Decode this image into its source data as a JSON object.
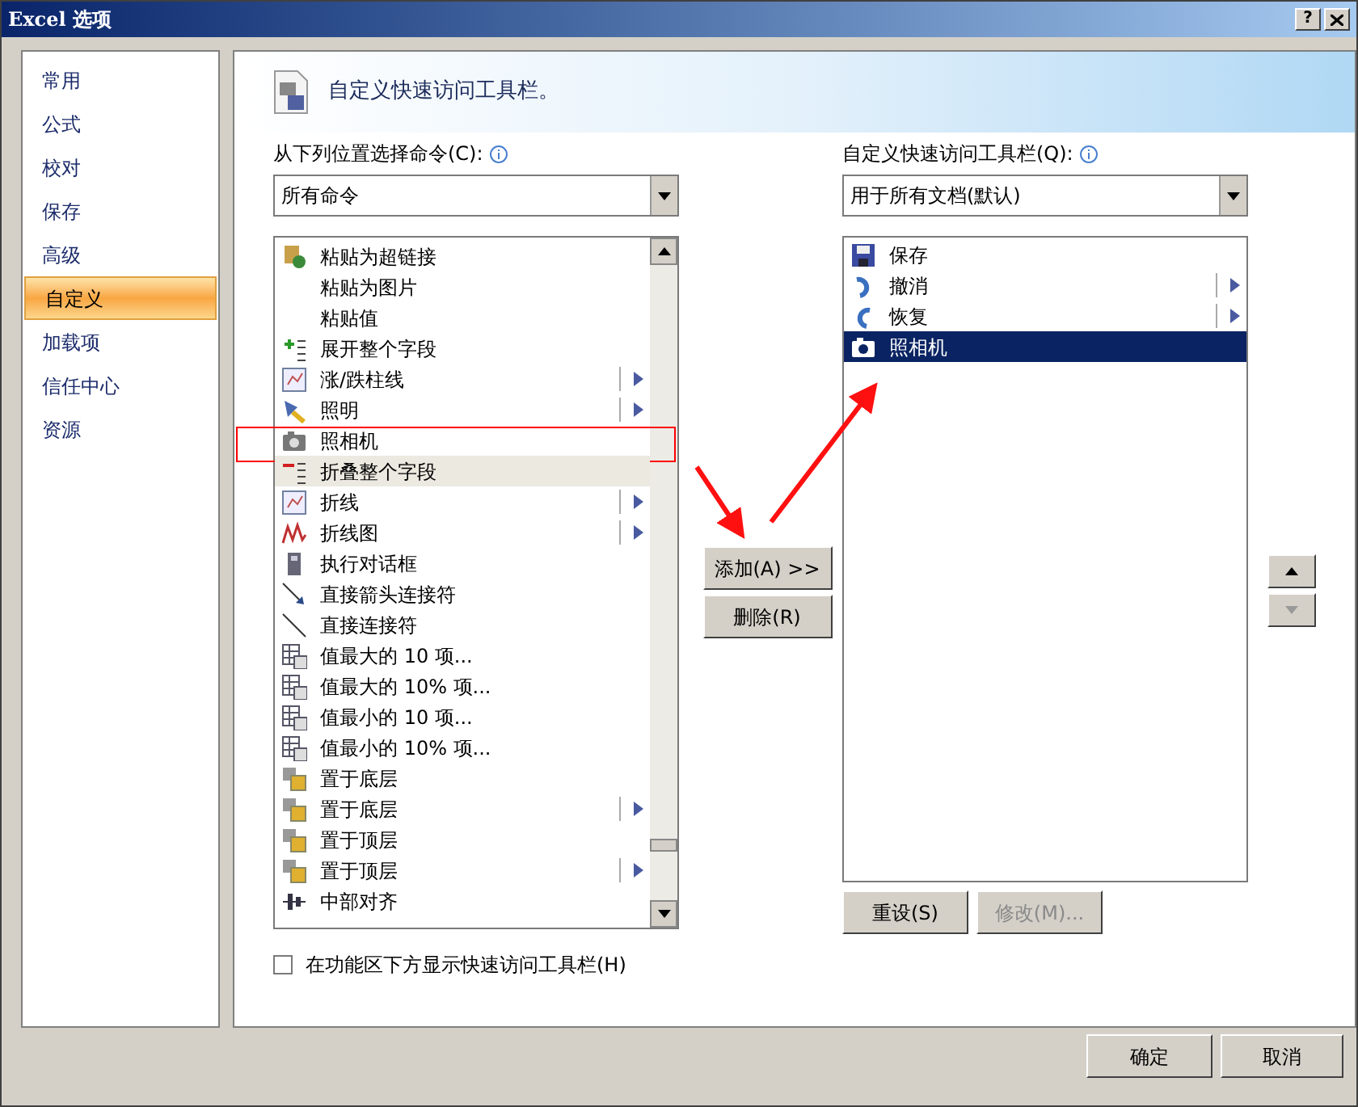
{
  "window": {
    "title": "Excel 选项",
    "help": "?"
  },
  "sidebar": {
    "items": [
      {
        "label": "常用",
        "selected": false
      },
      {
        "label": "公式",
        "selected": false
      },
      {
        "label": "校对",
        "selected": false
      },
      {
        "label": "保存",
        "selected": false
      },
      {
        "label": "高级",
        "selected": false
      },
      {
        "label": "自定义",
        "selected": true
      },
      {
        "label": "加载项",
        "selected": false
      },
      {
        "label": "信任中心",
        "selected": false
      },
      {
        "label": "资源",
        "selected": false
      }
    ]
  },
  "header": "自定义快速访问工具栏。",
  "commands": {
    "label": "从下列位置选择命令(C):",
    "dropdown": "所有命令",
    "items": [
      {
        "label": "粘贴为超链接",
        "submenu": false,
        "selected": false
      },
      {
        "label": "粘贴为图片",
        "submenu": false,
        "selected": false
      },
      {
        "label": "粘贴值",
        "submenu": false,
        "selected": false
      },
      {
        "label": "展开整个字段",
        "submenu": false,
        "selected": false
      },
      {
        "label": "涨/跌柱线",
        "submenu": true,
        "selected": false
      },
      {
        "label": "照明",
        "submenu": true,
        "selected": false
      },
      {
        "label": "照相机",
        "submenu": false,
        "selected": false
      },
      {
        "label": "折叠整个字段",
        "submenu": false,
        "selected": true
      },
      {
        "label": "折线",
        "submenu": true,
        "selected": false
      },
      {
        "label": "折线图",
        "submenu": true,
        "selected": false
      },
      {
        "label": "执行对话框",
        "submenu": false,
        "selected": false
      },
      {
        "label": "直接箭头连接符",
        "submenu": false,
        "selected": false
      },
      {
        "label": "直接连接符",
        "submenu": false,
        "selected": false
      },
      {
        "label": "值最大的 10 项...",
        "submenu": false,
        "selected": false
      },
      {
        "label": "值最大的 10% 项...",
        "submenu": false,
        "selected": false
      },
      {
        "label": "值最小的 10 项...",
        "submenu": false,
        "selected": false
      },
      {
        "label": "值最小的 10% 项...",
        "submenu": false,
        "selected": false
      },
      {
        "label": "置于底层",
        "submenu": false,
        "selected": false
      },
      {
        "label": "置于底层",
        "submenu": true,
        "selected": false
      },
      {
        "label": "置于顶层",
        "submenu": false,
        "selected": false
      },
      {
        "label": "置于顶层",
        "submenu": true,
        "selected": false
      },
      {
        "label": "中部对齐",
        "submenu": false,
        "selected": false
      }
    ]
  },
  "add_button": "添加(A) >>",
  "remove_button": "删除(R)",
  "toolbar": {
    "label": "自定义快速访问工具栏(Q):",
    "dropdown": "用于所有文档(默认)",
    "items": [
      {
        "label": "保存",
        "submenu": false,
        "selected": false
      },
      {
        "label": "撤消",
        "submenu": true,
        "selected": false
      },
      {
        "label": "恢复",
        "submenu": true,
        "selected": false
      },
      {
        "label": "照相机",
        "submenu": false,
        "selected": true
      }
    ]
  },
  "reset_button": {
    "label": "重设(S)",
    "disabled": false
  },
  "modify_button": {
    "label": "修改(M)...",
    "disabled": true
  },
  "show_below_ribbon": {
    "label": "在功能区下方显示快速访问工具栏(H)",
    "checked": false
  },
  "footer": {
    "ok": "确定",
    "cancel": "取消"
  }
}
